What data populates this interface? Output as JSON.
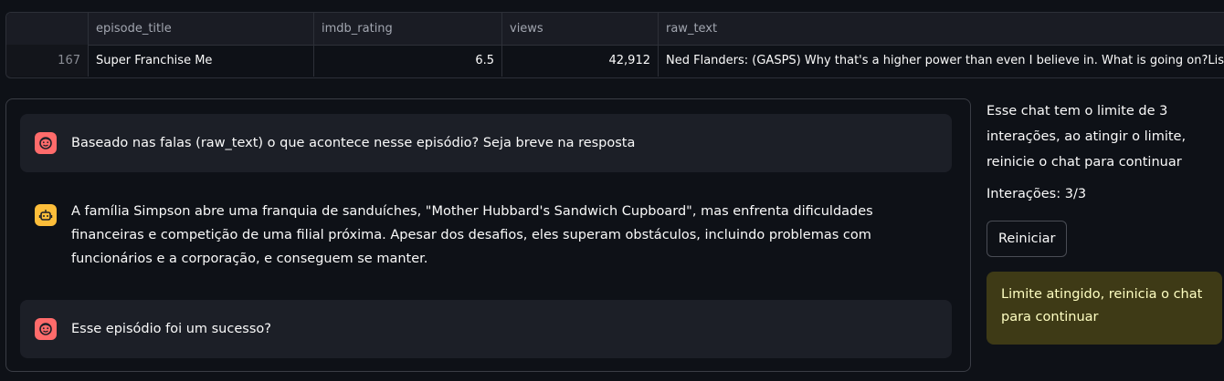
{
  "table": {
    "columns": [
      "",
      "episode_title",
      "imdb_rating",
      "views",
      "raw_text"
    ],
    "row": {
      "index": "167",
      "episode_title": "Super Franchise Me",
      "imdb_rating": "6.5",
      "views": "42,912",
      "raw_text": "Ned Flanders: (GASPS) Why that's a higher power than even I believe in. What is going on?Lisa Simpson: (I"
    }
  },
  "chat": {
    "messages": [
      {
        "role": "user",
        "icon": "face-icon",
        "text": "Baseado nas falas (raw_text) o que acontece nesse episódio? Seja breve na resposta"
      },
      {
        "role": "assistant",
        "icon": "robot-icon",
        "text": "A família Simpson abre uma franquia de sanduíches, \"Mother Hubbard's Sandwich Cupboard\", mas enfrenta dificuldades financeiras e competição de uma filial próxima. Apesar dos desafios, eles superam obstáculos, incluindo problemas com funcionários e a corporação, e conseguem se manter."
      },
      {
        "role": "user",
        "icon": "face-icon",
        "text": "Esse episódio foi um sucesso?"
      }
    ],
    "colors": {
      "user_avatar": "#ff6b6b",
      "bot_avatar": "#fdbe3a"
    }
  },
  "sidebar": {
    "info": "Esse chat tem o limite de 3 interações, ao atingir o limite, reinicie o chat para continuar",
    "count": "Interações: 3/3",
    "reset_label": "Reiniciar",
    "warning": "Limite atingido, reinicia o chat para continuar",
    "warning_color": "#3e3a16"
  }
}
